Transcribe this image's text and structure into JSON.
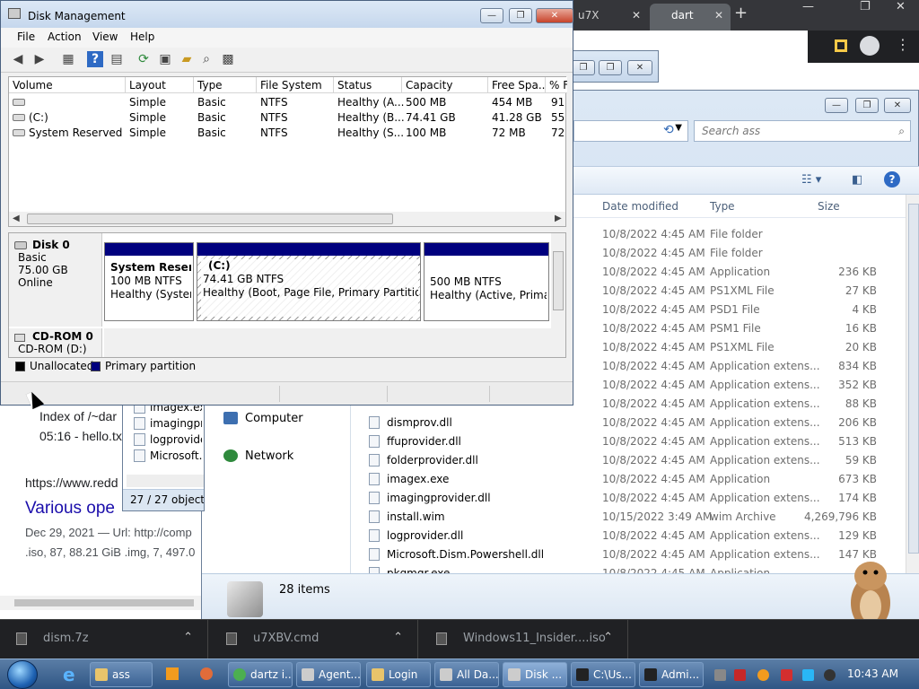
{
  "browser": {
    "tab1_label": "u7X",
    "tab2_label": "dart",
    "tab_close": "✕",
    "new_tab": "+",
    "window_controls": [
      "—",
      "❐",
      "✕"
    ],
    "menu_glyph": "⋮",
    "results": {
      "index_line": "Index of /~dar",
      "hello_line": "05:16 - hello.tx",
      "url_line": "https://www.redd",
      "title_line": "Various ope",
      "date_line": "Dec 29, 2021 — Url: http://comp",
      "stats_line": ".iso, 87, 88.21 GiB .img, 7, 497.0"
    }
  },
  "explorer": {
    "window_controls": [
      "—",
      "❐",
      "✕"
    ],
    "search_placeholder": "Search ass",
    "search_icon": "⌕",
    "refresh_icon": "⟲",
    "view_icon": "☷ ▾",
    "pane_icon": "◧",
    "help_icon": "?",
    "columns": {
      "date": "Date modified",
      "type": "Type",
      "size": "Size"
    },
    "rows": [
      {
        "name": "",
        "date": "10/8/2022 4:45 AM",
        "type": "File folder",
        "size": ""
      },
      {
        "name": "",
        "date": "10/8/2022 4:45 AM",
        "type": "File folder",
        "size": ""
      },
      {
        "name": "",
        "date": "10/8/2022 4:45 AM",
        "type": "Application",
        "size": "236 KB"
      },
      {
        "name": "",
        "date": "10/8/2022 4:45 AM",
        "type": "PS1XML File",
        "size": "27 KB"
      },
      {
        "name": "",
        "date": "10/8/2022 4:45 AM",
        "type": "PSD1 File",
        "size": "4 KB"
      },
      {
        "name": "",
        "date": "10/8/2022 4:45 AM",
        "type": "PSM1 File",
        "size": "16 KB"
      },
      {
        "name": "",
        "date": "10/8/2022 4:45 AM",
        "type": "PS1XML File",
        "size": "20 KB"
      },
      {
        "name": "",
        "date": "10/8/2022 4:45 AM",
        "type": "Application extens...",
        "size": "834 KB"
      },
      {
        "name": "",
        "date": "10/8/2022 4:45 AM",
        "type": "Application extens...",
        "size": "352 KB"
      },
      {
        "name": "",
        "date": "10/8/2022 4:45 AM",
        "type": "Application extens...",
        "size": "88 KB"
      },
      {
        "name": "dismprov.dll",
        "date": "10/8/2022 4:45 AM",
        "type": "Application extens...",
        "size": "206 KB"
      },
      {
        "name": "ffuprovider.dll",
        "date": "10/8/2022 4:45 AM",
        "type": "Application extens...",
        "size": "513 KB"
      },
      {
        "name": "folderprovider.dll",
        "date": "10/8/2022 4:45 AM",
        "type": "Application extens...",
        "size": "59 KB"
      },
      {
        "name": "imagex.exe",
        "date": "10/8/2022 4:45 AM",
        "type": "Application",
        "size": "673 KB"
      },
      {
        "name": "imagingprovider.dll",
        "date": "10/8/2022 4:45 AM",
        "type": "Application extens...",
        "size": "174 KB"
      },
      {
        "name": "install.wim",
        "date": "10/15/2022 3:49 AM",
        "type": "wim Archive",
        "size": "4,269,796 KB"
      },
      {
        "name": "logprovider.dll",
        "date": "10/8/2022 4:45 AM",
        "type": "Application extens...",
        "size": "129 KB"
      },
      {
        "name": "Microsoft.Dism.Powershell.dll",
        "date": "10/8/2022 4:45 AM",
        "type": "Application extens...",
        "size": "147 KB"
      },
      {
        "name": "pkgmgr.exe",
        "date": "10/8/2022 4:45 AM",
        "type": "Application",
        "size": ""
      }
    ],
    "nav": {
      "computer": "Computer",
      "network": "Network"
    },
    "status_count": "28 items"
  },
  "mini_window": {
    "items": [
      "imagex.ex",
      "imagingpro",
      "logprovide",
      "Microsoft.D"
    ],
    "status": "27 / 27 object(s)"
  },
  "disk_management": {
    "title": "Disk Management",
    "window_controls": [
      "—",
      "❐",
      "✕"
    ],
    "menu": [
      "File",
      "Action",
      "View",
      "Help"
    ],
    "toolbar_icons": [
      "◀",
      "▶",
      "▦",
      "?",
      "▤",
      "⟳",
      "▣",
      "▰",
      "⌕",
      "▩"
    ],
    "columns": [
      "Volume",
      "Layout",
      "Type",
      "File System",
      "Status",
      "Capacity",
      "Free Spa...",
      "% F"
    ],
    "volumes": [
      {
        "volume": "",
        "layout": "Simple",
        "type": "Basic",
        "fs": "NTFS",
        "status": "Healthy (A...",
        "capacity": "500 MB",
        "free": "454 MB",
        "pct": "91"
      },
      {
        "volume": "(C:)",
        "layout": "Simple",
        "type": "Basic",
        "fs": "NTFS",
        "status": "Healthy (B...",
        "capacity": "74.41 GB",
        "free": "41.28 GB",
        "pct": "55"
      },
      {
        "volume": "System Reserved",
        "layout": "Simple",
        "type": "Basic",
        "fs": "NTFS",
        "status": "Healthy (S...",
        "capacity": "100 MB",
        "free": "72 MB",
        "pct": "72"
      }
    ],
    "disk0": {
      "name": "Disk 0",
      "type": "Basic",
      "size": "75.00 GB",
      "state": "Online",
      "partitions": [
        {
          "name": "System Reserve",
          "size": "100 MB NTFS",
          "status": "Healthy (System,"
        },
        {
          "name": "(C:)",
          "size": "74.41 GB NTFS",
          "status": "Healthy (Boot, Page File, Primary Partition)"
        },
        {
          "name": "",
          "size": "500 MB NTFS",
          "status": "Healthy (Active, Primary"
        }
      ]
    },
    "cdrom": {
      "name": "CD-ROM 0",
      "drive": "CD-ROM (D:)"
    },
    "legend": {
      "unallocated": "Unallocated",
      "primary": "Primary partition"
    },
    "colors": {
      "primary": "#00007e",
      "unallocated": "#000000"
    }
  },
  "downloads": [
    {
      "name": "dism.7z",
      "chev": "⌃"
    },
    {
      "name": "u7XBV.cmd",
      "chev": "⌃"
    },
    {
      "name": "Windows11_Insider....iso",
      "chev": "⌃"
    }
  ],
  "taskbar": {
    "buttons": [
      "ass",
      "dartz i...",
      "Agent...",
      "Login",
      "All Da...",
      "Disk ...",
      "C:\\Us...",
      "Admi..."
    ],
    "clock": "10:43 AM"
  }
}
